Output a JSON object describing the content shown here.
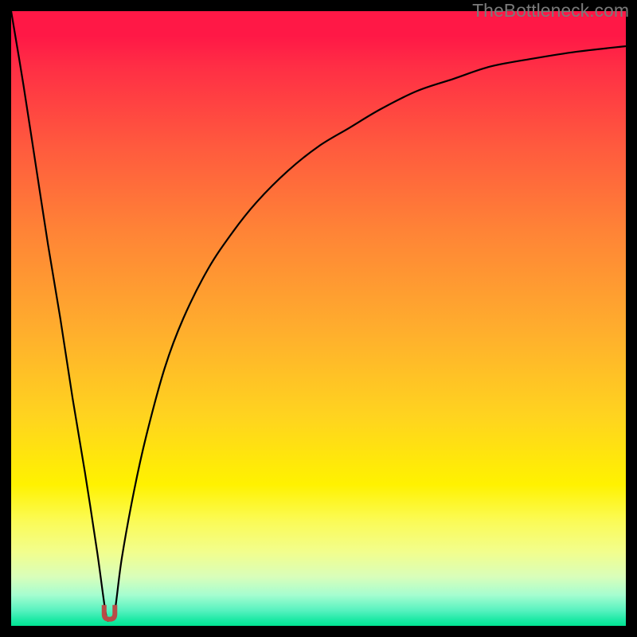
{
  "attribution": "TheBottleneck.com",
  "colors": {
    "curve_stroke": "#000000",
    "marker_fill": "#b84c47",
    "background_black": "#000000"
  },
  "chart_data": {
    "type": "line",
    "title": "",
    "xlabel": "",
    "ylabel": "",
    "xlim": [
      0,
      100
    ],
    "ylim": [
      0,
      100
    ],
    "grid": false,
    "series": [
      {
        "name": "bottleneck-curve",
        "x": [
          0,
          2,
          4,
          6,
          8,
          10,
          12,
          14,
          15.4,
          16.0,
          16.8,
          18,
          20,
          22,
          25,
          28,
          32,
          36,
          40,
          45,
          50,
          55,
          60,
          66,
          72,
          78,
          85,
          92,
          100
        ],
        "values": [
          100,
          88,
          75,
          62,
          50,
          37,
          25,
          12,
          2,
          1.0,
          2,
          11,
          22,
          31,
          42,
          50,
          58,
          64,
          69,
          74,
          78,
          81,
          84,
          87,
          89,
          91,
          92.3,
          93.4,
          94.3
        ]
      }
    ],
    "trough": {
      "x": 16.0,
      "y": 1.0,
      "width": 2.4
    }
  }
}
